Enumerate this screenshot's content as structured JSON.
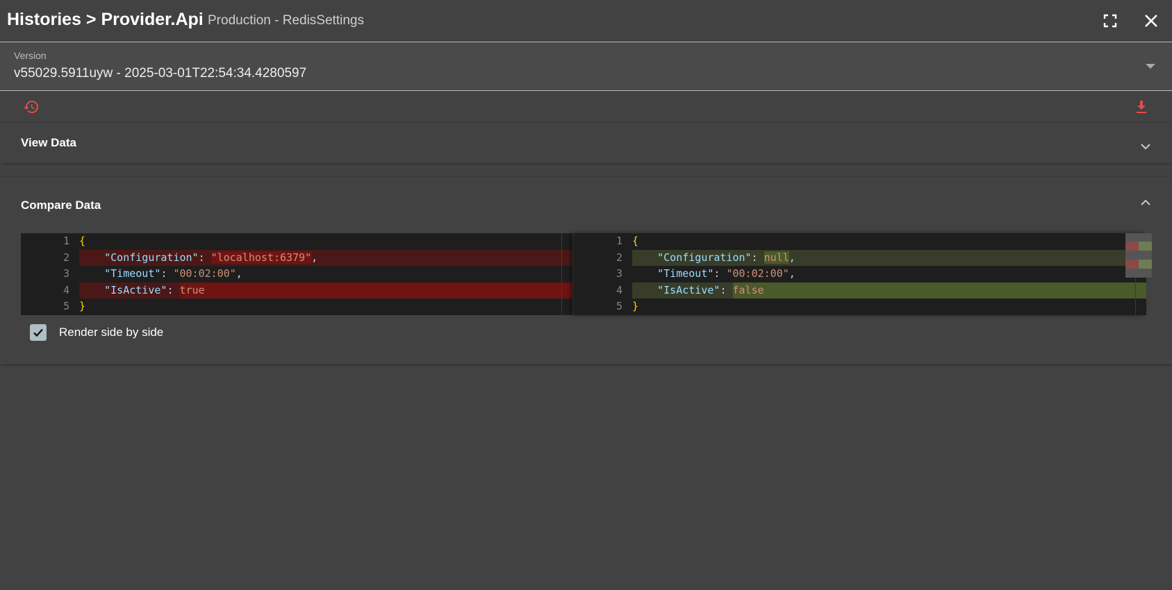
{
  "header": {
    "title": "Histories > Provider.Api",
    "subtitle": "Production - RedisSettings"
  },
  "version": {
    "label": "Version",
    "value": "v55029.5911uyw - 2025-03-01T22:54:34.4280597"
  },
  "panels": {
    "view_data": {
      "title": "View Data",
      "expanded": false
    },
    "compare_data": {
      "title": "Compare Data",
      "expanded": true
    }
  },
  "diff": {
    "left": {
      "lines": [
        {
          "n": "1",
          "open": "{"
        },
        {
          "n": "2",
          "key": "\"Configuration\"",
          "value": "\"localhost:6379\"",
          "trail": ",",
          "change": "removed"
        },
        {
          "n": "3",
          "key": "\"Timeout\"",
          "value": "\"00:02:00\"",
          "trail": ",",
          "change": "none"
        },
        {
          "n": "4",
          "key": "\"IsActive\"",
          "value": "true",
          "trail": "",
          "change": "removed"
        },
        {
          "n": "5",
          "open": "}"
        }
      ]
    },
    "right": {
      "lines": [
        {
          "n": "1",
          "open": "{"
        },
        {
          "n": "2",
          "key": "\"Configuration\"",
          "value": "null",
          "trail": ",",
          "change": "added"
        },
        {
          "n": "3",
          "key": "\"Timeout\"",
          "value": "\"00:02:00\"",
          "trail": ",",
          "change": "none"
        },
        {
          "n": "4",
          "key": "\"IsActive\"",
          "value": "false",
          "trail": "",
          "change": "added"
        },
        {
          "n": "5",
          "open": "}"
        }
      ]
    },
    "colors": {
      "removed_line": "#4b1818",
      "removed_token": "#6f1313",
      "added_line": "#373d29",
      "added_token": "#4b5a2a"
    }
  },
  "options": {
    "render_side_by_side": {
      "label": "Render side by side",
      "checked": true
    }
  },
  "accent_color": "#e84a4a"
}
